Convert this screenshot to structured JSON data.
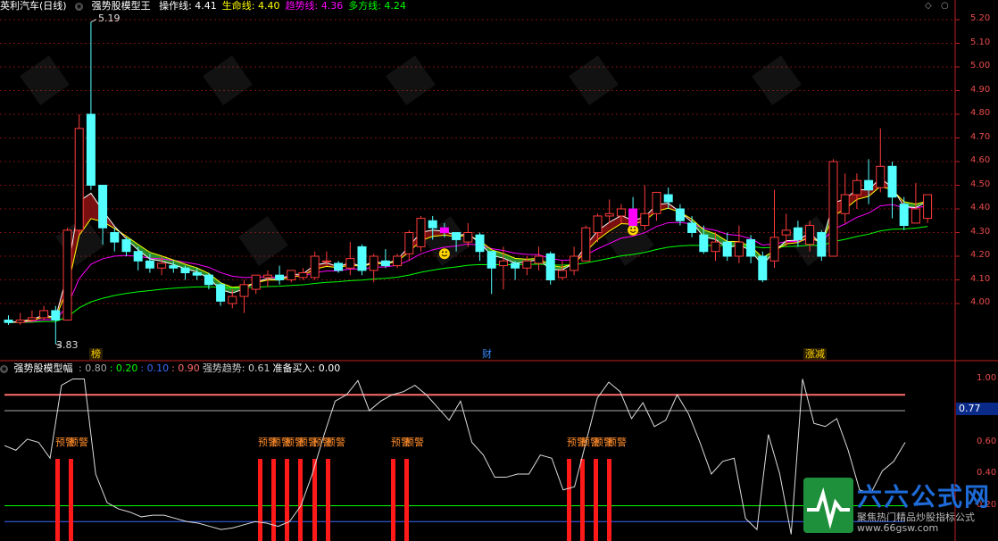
{
  "header": {
    "stock_name": "英利汽车(日线)",
    "indicator_name": "强势股模型王",
    "lines": [
      {
        "label": "操作线",
        "value": "4.41",
        "color": "#ffffff"
      },
      {
        "label": "生命线",
        "value": "4.40",
        "color": "#ffff00"
      },
      {
        "label": "趋势线",
        "value": "4.36",
        "color": "#ff00ff"
      },
      {
        "label": "多方线",
        "value": "4.24",
        "color": "#00ff00"
      }
    ],
    "window_controls": [
      "◇",
      "○"
    ]
  },
  "price_axis": {
    "ticks": [
      "5.20",
      "5.10",
      "5.00",
      "4.90",
      "4.80",
      "4.70",
      "4.60",
      "4.50",
      "4.40",
      "4.30",
      "4.20",
      "4.10",
      "4.00"
    ],
    "high_label": "5.19",
    "low_label": "3.83"
  },
  "event_tags": [
    {
      "text": "榜",
      "color": "#ffd200"
    },
    {
      "text": "财",
      "color": "#3a8bff"
    },
    {
      "text": "涨减",
      "color": "#ffd200"
    }
  ],
  "sub_header": {
    "name": "强势股模型幅",
    "values": [
      {
        "text": ": 0.80",
        "color": "#aaaaaa"
      },
      {
        "text": ": 0.20",
        "color": "#00ff00"
      },
      {
        "text": ": 0.10",
        "color": "#3a6bff"
      },
      {
        "text": ": 0.90",
        "color": "#ff6b6b"
      },
      {
        "text": "强势趋势: 0.61",
        "color": "#cccccc"
      },
      {
        "text": "准备买入: 0.00",
        "color": "#ffffff"
      }
    ]
  },
  "sub_axis": {
    "ticks": [
      "1.00",
      "0.80",
      "0.60",
      "0.40",
      "0.20"
    ],
    "current_value": "0.77"
  },
  "warnings": [
    "预警",
    "预警",
    "预警",
    "预警",
    "预警",
    "预警",
    "预警",
    "预警",
    "预警",
    "预警",
    "预警",
    "预警",
    "预警",
    "预警"
  ],
  "warning_color": "#ff8c2a",
  "watermark": {
    "brand": "六六公式网",
    "slogan": "聚焦热门精品炒股指标公式",
    "url": "www.66gsw.com"
  },
  "colors": {
    "up": "#ff3b3b",
    "down": "#54ffff",
    "grid": "#7a1010",
    "axis": "#c02020"
  },
  "chart_data": {
    "type": "candlestick",
    "candles": [
      [
        3.93,
        3.92,
        3.95,
        3.91
      ],
      [
        3.92,
        3.93,
        3.96,
        3.91
      ],
      [
        3.93,
        3.94,
        3.97,
        3.92
      ],
      [
        3.94,
        3.97,
        3.99,
        3.93
      ],
      [
        3.97,
        3.93,
        3.99,
        3.83
      ],
      [
        3.93,
        4.31,
        4.32,
        3.93
      ],
      [
        4.31,
        4.74,
        4.8,
        4.29
      ],
      [
        4.8,
        4.5,
        5.19,
        4.48
      ],
      [
        4.5,
        4.32,
        4.4,
        4.25
      ],
      [
        4.3,
        4.26,
        4.32,
        4.22
      ],
      [
        4.27,
        4.22,
        4.28,
        4.2
      ],
      [
        4.22,
        4.18,
        4.24,
        4.14
      ],
      [
        4.18,
        4.15,
        4.21,
        4.13
      ],
      [
        4.15,
        4.17,
        4.2,
        4.12
      ],
      [
        4.16,
        4.15,
        4.18,
        4.13
      ],
      [
        4.15,
        4.13,
        4.16,
        4.1
      ],
      [
        4.13,
        4.12,
        4.15,
        4.1
      ],
      [
        4.12,
        4.08,
        4.13,
        4.06
      ],
      [
        4.08,
        4.01,
        4.09,
        3.99
      ],
      [
        4.0,
        4.03,
        4.06,
        3.98
      ],
      [
        4.03,
        4.08,
        4.1,
        3.96
      ],
      [
        4.06,
        4.12,
        4.12,
        4.04
      ],
      [
        4.11,
        4.12,
        4.14,
        4.07
      ],
      [
        4.12,
        4.1,
        4.16,
        4.08
      ],
      [
        4.1,
        4.14,
        4.14,
        4.09
      ],
      [
        4.11,
        4.13,
        4.15,
        4.1
      ],
      [
        4.11,
        4.2,
        4.22,
        4.1
      ],
      [
        4.18,
        4.18,
        4.22,
        4.16
      ],
      [
        4.17,
        4.14,
        4.18,
        4.13
      ],
      [
        4.15,
        4.19,
        4.26,
        4.12
      ],
      [
        4.24,
        4.14,
        4.25,
        4.12
      ],
      [
        4.14,
        4.2,
        4.21,
        4.09
      ],
      [
        4.18,
        4.16,
        4.23,
        4.15
      ],
      [
        4.16,
        4.2,
        4.21,
        4.15
      ],
      [
        4.21,
        4.3,
        4.31,
        4.18
      ],
      [
        4.24,
        4.36,
        4.37,
        4.22
      ],
      [
        4.35,
        4.32,
        4.37,
        4.27
      ],
      [
        4.32,
        4.3,
        4.34,
        4.28
      ],
      [
        4.3,
        4.27,
        4.3,
        4.22
      ],
      [
        4.26,
        4.3,
        4.34,
        4.24
      ],
      [
        4.29,
        4.22,
        4.3,
        4.18
      ],
      [
        4.22,
        4.15,
        4.22,
        4.04
      ],
      [
        4.16,
        4.18,
        4.24,
        4.06
      ],
      [
        4.17,
        4.15,
        4.18,
        4.1
      ],
      [
        4.15,
        4.18,
        4.2,
        4.12
      ],
      [
        4.17,
        4.2,
        4.24,
        4.14
      ],
      [
        4.21,
        4.1,
        4.22,
        4.08
      ],
      [
        4.11,
        4.14,
        4.18,
        4.1
      ],
      [
        4.14,
        4.2,
        4.24,
        4.12
      ],
      [
        4.18,
        4.32,
        4.33,
        4.18
      ],
      [
        4.3,
        4.37,
        4.38,
        4.26
      ],
      [
        4.37,
        4.38,
        4.44,
        4.34
      ],
      [
        4.37,
        4.4,
        4.42,
        4.34
      ],
      [
        4.4,
        4.33,
        4.45,
        4.32
      ],
      [
        4.33,
        4.38,
        4.5,
        4.31
      ],
      [
        4.38,
        4.47,
        4.47,
        4.35
      ],
      [
        4.46,
        4.43,
        4.49,
        4.4
      ],
      [
        4.4,
        4.35,
        4.42,
        4.33
      ],
      [
        4.34,
        4.3,
        4.37,
        4.28
      ],
      [
        4.29,
        4.22,
        4.33,
        4.21
      ],
      [
        4.22,
        4.26,
        4.3,
        4.18
      ],
      [
        4.26,
        4.2,
        4.3,
        4.18
      ],
      [
        4.2,
        4.26,
        4.33,
        4.17
      ],
      [
        4.27,
        4.2,
        4.29,
        4.17
      ],
      [
        4.2,
        4.1,
        4.22,
        4.09
      ],
      [
        4.18,
        4.28,
        4.48,
        4.15
      ],
      [
        4.29,
        4.31,
        4.38,
        4.24
      ],
      [
        4.32,
        4.27,
        4.35,
        4.24
      ],
      [
        4.25,
        4.33,
        4.35,
        4.22
      ],
      [
        4.3,
        4.2,
        4.31,
        4.18
      ],
      [
        4.2,
        4.6,
        4.61,
        4.2
      ],
      [
        4.38,
        4.46,
        4.55,
        4.34
      ],
      [
        4.46,
        4.52,
        4.55,
        4.4
      ],
      [
        4.52,
        4.48,
        4.61,
        4.42
      ],
      [
        4.49,
        4.58,
        4.74,
        4.47
      ],
      [
        4.58,
        4.45,
        4.6,
        4.36
      ],
      [
        4.42,
        4.33,
        4.45,
        4.31
      ],
      [
        4.34,
        4.4,
        4.51,
        4.36
      ],
      [
        4.36,
        4.46,
        4.46,
        4.34
      ]
    ],
    "ma_lines": [
      {
        "name": "操作线",
        "color": "#ffffff"
      },
      {
        "name": "生命线",
        "color": "#ffff00"
      },
      {
        "name": "趋势线",
        "color": "#ff00ff"
      },
      {
        "name": "多方线",
        "color": "#00ff00"
      }
    ],
    "oscillator": [
      0.58,
      0.55,
      0.62,
      0.6,
      0.5,
      0.96,
      1.0,
      1.0,
      0.4,
      0.22,
      0.18,
      0.16,
      0.13,
      0.14,
      0.14,
      0.12,
      0.1,
      0.09,
      0.07,
      0.05,
      0.06,
      0.08,
      0.1,
      0.09,
      0.07,
      0.1,
      0.2,
      0.4,
      0.64,
      0.86,
      0.9,
      0.99,
      0.8,
      0.86,
      0.9,
      0.92,
      0.96,
      0.9,
      0.82,
      0.74,
      0.86,
      0.6,
      0.52,
      0.38,
      0.38,
      0.4,
      0.4,
      0.52,
      0.5,
      0.3,
      0.32,
      0.6,
      0.88,
      0.98,
      0.92,
      0.75,
      0.85,
      0.7,
      0.74,
      0.9,
      0.78,
      0.6,
      0.4,
      0.48,
      0.5,
      0.12,
      0.05,
      0.65,
      0.4,
      0.02,
      1.0,
      0.72,
      0.7,
      0.75,
      0.55,
      0.3,
      0.28,
      0.42,
      0.48,
      0.6
    ],
    "signal_bars": [
      4,
      5,
      21,
      22,
      23,
      24,
      25,
      26,
      31,
      32,
      44,
      45,
      46,
      47
    ],
    "ref_lines": [
      0.8,
      0.2,
      0.1,
      0.9
    ]
  }
}
